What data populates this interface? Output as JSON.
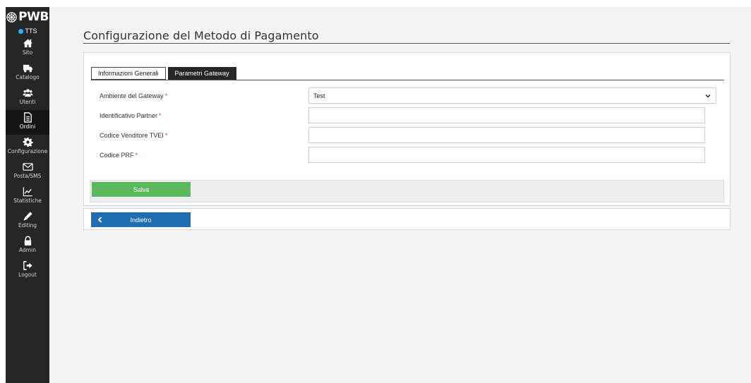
{
  "brand": {
    "name": "PWB"
  },
  "site_status": {
    "label": "TTS",
    "dot_color": "#29b6f6"
  },
  "sidebar": {
    "items": [
      {
        "label": "Sito",
        "icon": "home-icon",
        "active": false
      },
      {
        "label": "Catalogo",
        "icon": "truck-icon",
        "active": false
      },
      {
        "label": "Utenti",
        "icon": "users-icon",
        "active": false
      },
      {
        "label": "Ordini",
        "icon": "document-icon",
        "active": true
      },
      {
        "label": "Configurazione",
        "icon": "gear-icon",
        "active": false
      },
      {
        "label": "Posta/SMS",
        "icon": "envelope-icon",
        "active": false
      },
      {
        "label": "Statistiche",
        "icon": "chart-icon",
        "active": false
      },
      {
        "label": "Editing",
        "icon": "pencil-icon",
        "active": false
      },
      {
        "label": "Admin",
        "icon": "lock-icon",
        "active": false
      },
      {
        "label": "Logout",
        "icon": "logout-icon",
        "active": false
      }
    ]
  },
  "page": {
    "title": "Configurazione del Metodo di Pagamento"
  },
  "tabs": [
    {
      "label": "Informazioni Generali",
      "active": false
    },
    {
      "label": "Parametri Gateway",
      "active": true
    }
  ],
  "form": {
    "required_marker": "*",
    "fields": [
      {
        "label": "Ambiente del Gateway",
        "type": "select",
        "value": "Test"
      },
      {
        "label": "Identificativo Partner",
        "type": "text",
        "value": ""
      },
      {
        "label": "Codice Venditore TVEI",
        "type": "text",
        "value": ""
      },
      {
        "label": "Codice PRF",
        "type": "text",
        "value": ""
      }
    ]
  },
  "actions": {
    "save_label": "Salva",
    "back_label": "Indietro"
  },
  "colors": {
    "sidebar_bg": "#262626",
    "save_green": "#5cb85c",
    "back_blue": "#1f6eb4",
    "required_red": "#dd3333"
  }
}
